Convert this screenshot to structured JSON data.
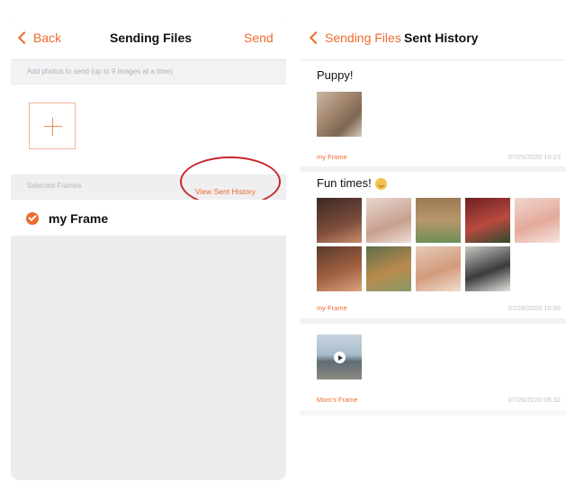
{
  "left_screen": {
    "back_label": "Back",
    "title": "Sending Files",
    "send_label": "Send",
    "hint": "Add photos to send (up to 9 images at a time)",
    "selected_frames_label": "Selected Frames",
    "view_history_label": "View Sent History",
    "frame_name": "my Frame"
  },
  "right_screen": {
    "back_label": "Sending Files",
    "title": "Sent History",
    "entries": [
      {
        "title": "Puppy!",
        "frame": "my Frame",
        "date": "07/25/2020 10:23"
      },
      {
        "title": "Fun times!",
        "frame": "my Frame",
        "date": "07/26/2020 10:06"
      },
      {
        "title": "",
        "frame": "Mom's Frame",
        "date": "07/26/2020 08:32"
      }
    ]
  },
  "colors": {
    "accent": "#ef6a2e",
    "highlight_ring": "#c7272d"
  },
  "icons": {
    "back": "chevron-left-icon",
    "add": "plus-icon",
    "selected": "checkmark-circle-icon",
    "video": "play-icon",
    "emoji": "smiling-face-emoji"
  }
}
